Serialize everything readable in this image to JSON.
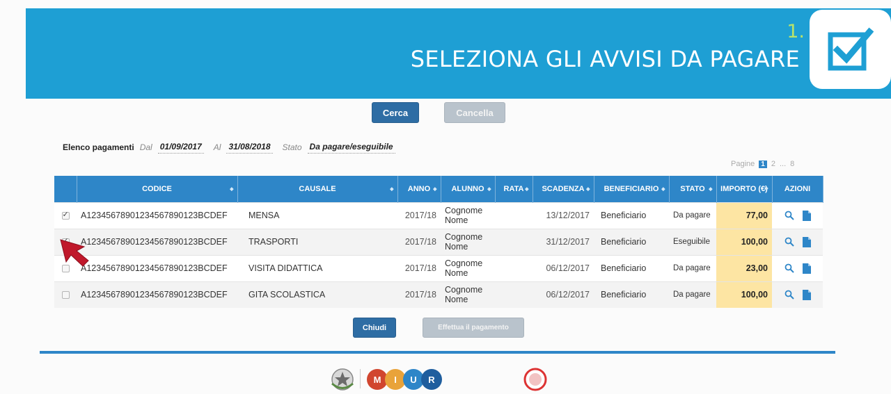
{
  "banner": {
    "step": "1.",
    "title": "SELEZIONA GLI AVVISI DA PAGARE",
    "icon": "checkbox-icon",
    "color": "#1e9fd4"
  },
  "search": {
    "cerca_label": "Cerca",
    "cancella_label": "Cancella"
  },
  "summary": {
    "label": "Elenco pagamenti",
    "dal_label": "Dal",
    "dal_value": "01/09/2017",
    "al_label": "Al",
    "al_value": "31/08/2018",
    "stato_label": "Stato",
    "stato_value": "Da pagare/eseguibile"
  },
  "pagination": {
    "label": "Pagine",
    "current": "1",
    "next": "2",
    "ellipsis": "...",
    "last": "8"
  },
  "table": {
    "headers": {
      "codice": "CODICE",
      "causale": "CAUSALE",
      "anno": "ANNO",
      "alunno": "ALUNNO",
      "rata": "RATA",
      "scadenza": "SCADENZA",
      "beneficiario": "BENEFICIARIO",
      "stato": "STATO",
      "importo": "IMPORTO (€)",
      "azioni": "AZIONI"
    },
    "rows": [
      {
        "checked": true,
        "codice": "A12345678901234567890123BCDEF",
        "causale": "MENSA",
        "anno": "2017/18",
        "alunno": "Cognome Nome",
        "rata": "",
        "scadenza": "13/12/2017",
        "beneficiario": "Beneficiario",
        "stato": "Da pagare",
        "importo": "77,00"
      },
      {
        "checked": true,
        "codice": "A12345678901234567890123BCDEF",
        "causale": "TRASPORTI",
        "anno": "2017/18",
        "alunno": "Cognome Nome",
        "rata": "",
        "scadenza": "31/12/2017",
        "beneficiario": "Beneficiario",
        "stato": "Eseguibile",
        "importo": "100,00"
      },
      {
        "checked": false,
        "codice": "A12345678901234567890123BCDEF",
        "causale": "VISITA DIDATTICA",
        "anno": "2017/18",
        "alunno": "Cognome Nome",
        "rata": "",
        "scadenza": "06/12/2017",
        "beneficiario": "Beneficiario",
        "stato": "Da pagare",
        "importo": "23,00"
      },
      {
        "checked": false,
        "codice": "A12345678901234567890123BCDEF",
        "causale": "GITA SCOLASTICA",
        "anno": "2017/18",
        "alunno": "Cognome Nome",
        "rata": "",
        "scadenza": "06/12/2017",
        "beneficiario": "Beneficiario",
        "stato": "Da pagare",
        "importo": "100,00"
      }
    ]
  },
  "actions": {
    "chiudi_label": "Chiudi",
    "pay_label": "Effettua il pagamento"
  },
  "footer": {
    "logos": [
      "repubblica-emblem",
      "miur-logo",
      "pagopa-logo"
    ],
    "miur_letters": [
      "M",
      "I",
      "U",
      "R"
    ]
  },
  "colors": {
    "primary": "#2e6da4",
    "table_header": "#2e86c8",
    "importo_bg": "#fde5a3",
    "accent_step": "#b9e36a"
  }
}
